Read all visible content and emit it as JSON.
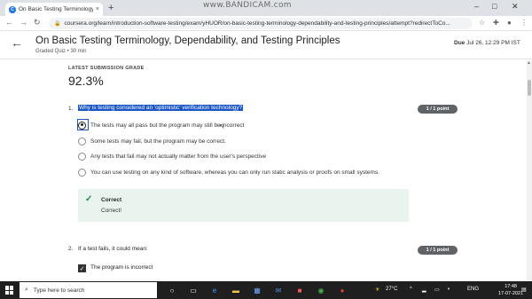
{
  "browser": {
    "tab_title": "On Basic Testing Terminology, D",
    "tab_close": "×",
    "new_tab": "+",
    "watermark": "www.BANDICAM.com",
    "url": "coursera.org/learn/introduction-software-testing/exam/yHUOR/on-basic-testing-terminology-dependability-and-testing-principles/attempt?redirectToCo..."
  },
  "header": {
    "title": "On Basic Testing Terminology, Dependability, and Testing Principles",
    "subtitle": "Graded Quiz • 30 min",
    "due_label": "Due",
    "due_value": "Jul 26, 12:29 PM IST"
  },
  "grade": {
    "label": "LATEST SUBMISSION GRADE",
    "value": "92.3%"
  },
  "questions": [
    {
      "number": "1.",
      "text": "Why is testing considered an 'optimistic' verification technology?",
      "points": "1 / 1 point",
      "options": [
        "The tests may all pass but the program may still be incorrect",
        "Some tests may fail, but the program may be correct.",
        "Any tests that fail may not actually matter from the user's perspective",
        "You can use testing on any kind of software, whereas you can only run static analysis or proofs on small systems."
      ],
      "feedback_title": "Correct",
      "feedback_body": "Correct!"
    },
    {
      "number": "2.",
      "text": "If a test fails, it could mean:",
      "points": "1 / 1 point",
      "options": [
        "The program is incorrect"
      ]
    }
  ],
  "taskbar": {
    "search_placeholder": "Type here to search",
    "weather": "27°C",
    "language": "ENG",
    "time": "17:48",
    "date": "17-07-2021"
  }
}
